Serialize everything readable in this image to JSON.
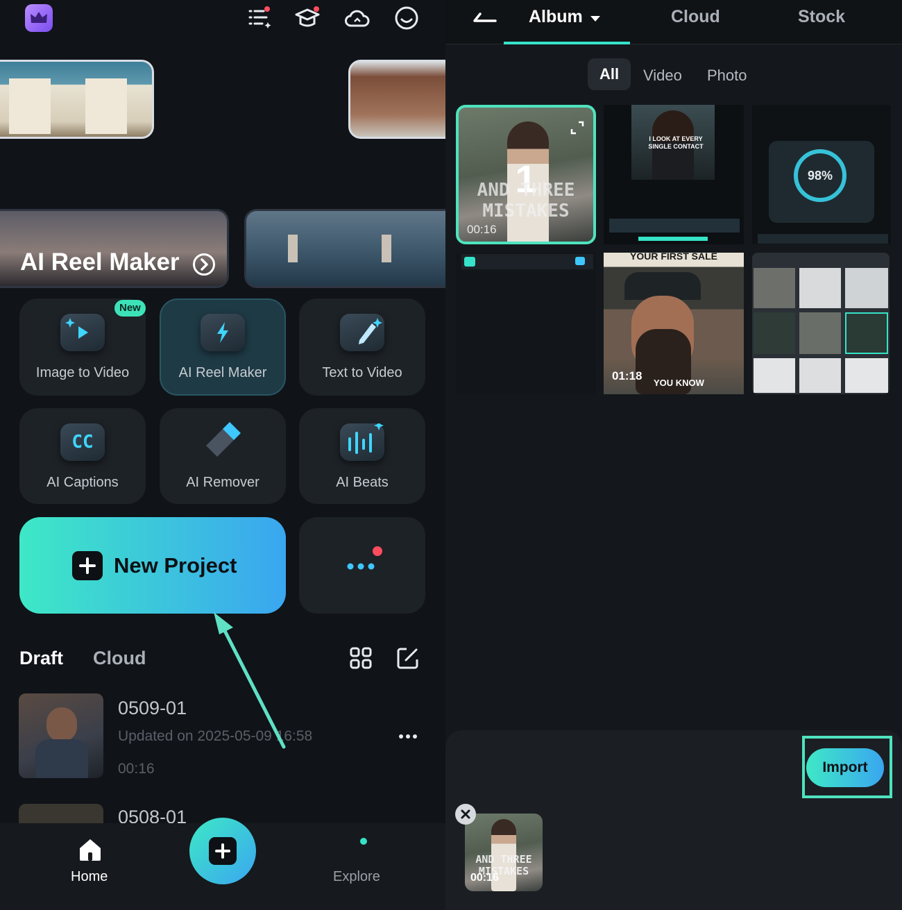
{
  "left": {
    "banner_title": "AI Reel Maker",
    "tools": [
      {
        "label": "Image to Video",
        "badge": "New",
        "icon": "image-to-video-icon"
      },
      {
        "label": "AI Reel Maker",
        "icon": "ai-reel-maker-icon"
      },
      {
        "label": "Text to Video",
        "icon": "text-to-video-icon"
      },
      {
        "label": "AI Captions",
        "icon": "cc-icon",
        "icon_text": "CC"
      },
      {
        "label": "AI Remover",
        "icon": "eraser-icon"
      },
      {
        "label": "AI Beats",
        "icon": "ai-beats-icon"
      }
    ],
    "new_project_label": "New Project",
    "tabs": {
      "draft": "Draft",
      "cloud": "Cloud"
    },
    "drafts": [
      {
        "name": "0509-01",
        "updated": "Updated on 2025-05-09 16:58",
        "duration": "00:16"
      },
      {
        "name": "0508-01"
      }
    ],
    "nav": {
      "home": "Home",
      "explore": "Explore"
    },
    "colors": {
      "accent": "#36e3c8",
      "accent2": "#3aa8f2",
      "annotation": "#5fe0c4"
    }
  },
  "right": {
    "tabs": [
      "Album",
      "Cloud",
      "Stock"
    ],
    "filters": [
      "All",
      "Video",
      "Photo"
    ],
    "media": [
      {
        "duration": "00:16",
        "overlay": "AND THREE MISTAKES",
        "number": "1"
      },
      {
        "overlay": "I LOOK AT EVERY SINGLE CONTACT"
      },
      {
        "overlay": "98%"
      },
      {
        "overlay": "YOUR FIRST SALE",
        "duration": "01:18",
        "caption": "YOU KNOW"
      },
      {}
    ],
    "import_label": "Import",
    "selected": {
      "overlay": "AND THREE MISTAKES",
      "duration": "00:16"
    }
  }
}
